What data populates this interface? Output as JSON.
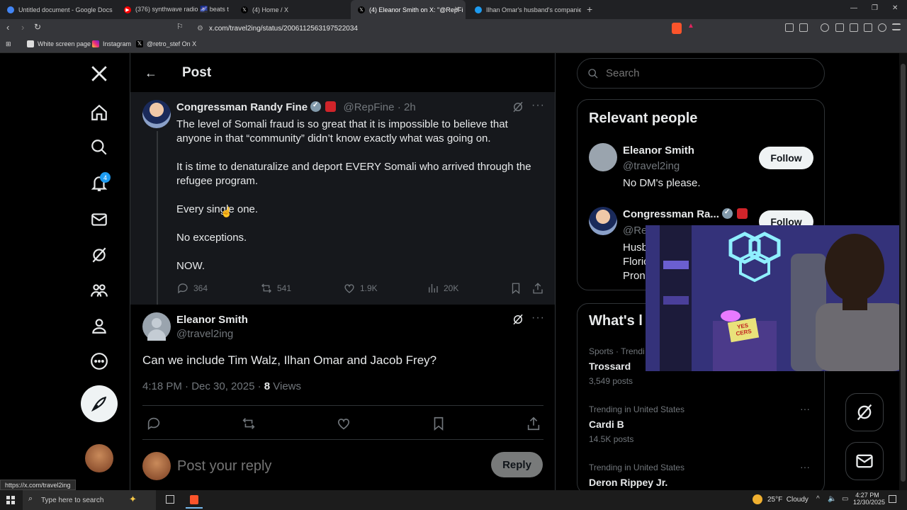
{
  "browser": {
    "tabs": [
      {
        "title": "Untitled document - Google Docs",
        "icon": "google-docs-icon",
        "color": "#4285f4"
      },
      {
        "title": "(376) synthwave radio 🌌 beats t",
        "icon": "youtube-icon",
        "color": "#ff0000"
      },
      {
        "title": "(4) Home / X",
        "icon": "x-logo-icon",
        "color": "#000000"
      },
      {
        "title": "(4) Eleanor Smith on X: \"@RepFi",
        "icon": "x-logo-icon",
        "color": "#000000"
      },
      {
        "title": "Ilhan Omar's husband's companies s",
        "icon": "x-logo-icon",
        "color": "#1d9bf0"
      }
    ],
    "url": "x.com/travel2ing/status/2006112563197522034",
    "bookmarks": [
      "White screen page",
      "Instagram",
      "@retro_stef On X"
    ],
    "status_url": "https://x.com/travel2ing"
  },
  "nav": {
    "notification_count": "4",
    "items": [
      "x-logo",
      "home",
      "explore",
      "notifications",
      "messages",
      "grok",
      "communities",
      "profile",
      "more"
    ]
  },
  "post_header": {
    "title": "Post"
  },
  "quoted_tweet": {
    "name": "Congressman Randy Fine",
    "handle": "@RepFine",
    "time": "· 2h",
    "text": "The level of Somali fraud is so great that it is impossible to believe that anyone in that “community” didn’t know exactly what was going on.\n\nIt is time to denaturalize and deport EVERY Somali who arrived through the refugee program.\n\nEvery single one.\n\nNo exceptions.\n\nNOW.",
    "replies": "364",
    "reposts": "541",
    "likes": "1.9K",
    "views": "20K"
  },
  "main_tweet": {
    "name": "Eleanor Smith",
    "handle": "@travel2ing",
    "text": "Can we include Tim Walz, Ilhan Omar and Jacob Frey?",
    "timestamp": "4:18 PM · Dec 30, 2025 · ",
    "views_count": "8",
    "views_label": " Views"
  },
  "reply_box": {
    "placeholder": "Post your reply",
    "button": "Reply"
  },
  "search": {
    "placeholder": "Search"
  },
  "relevant_people": {
    "title": "Relevant people",
    "people": [
      {
        "name": "Eleanor Smith",
        "handle": "@travel2ing",
        "bio": "No DM's please.",
        "button": "Follow"
      },
      {
        "name": "Congressman Ra...",
        "handle": "@Re",
        "bio": "Husb\nFloric\nProno",
        "button": "Follow"
      }
    ]
  },
  "trends": {
    "title": "What's l",
    "items": [
      {
        "meta": "Sports · Trendi",
        "title": "Trossard",
        "posts": "3,549 posts"
      },
      {
        "meta": "Trending in United States",
        "title": "Cardi B",
        "posts": "14.5K posts"
      },
      {
        "meta": "Trending in United States",
        "title": "Deron Rippey Jr.",
        "posts": ""
      }
    ]
  },
  "webcam": {
    "sign_text": "YES\nCERS"
  },
  "taskbar": {
    "search_placeholder": "Type here to search",
    "weather": "25°F  Cloudy",
    "time": "4:27 PM",
    "date": "12/30/2025"
  },
  "colors": {
    "accent": "#1d9bf0",
    "background": "#000000",
    "text": "#e7e9ea",
    "muted": "#71767b"
  }
}
